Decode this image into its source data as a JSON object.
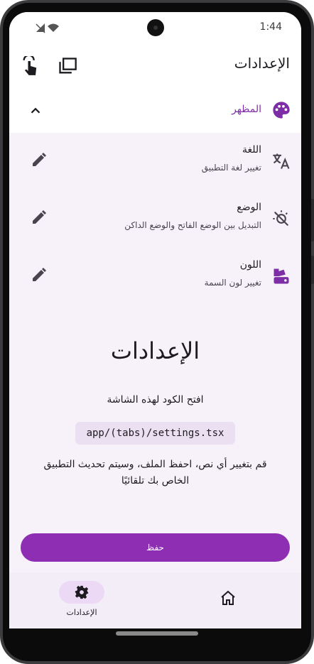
{
  "status_bar": {
    "time": "1:44"
  },
  "app_bar": {
    "title": "الإعدادات"
  },
  "accordion": {
    "label": "المظهر",
    "accent": "#7d2ea6"
  },
  "settings_items": [
    {
      "title": "اللغة",
      "subtitle": "تغيير لغة التطبيق",
      "icon": "translate-icon"
    },
    {
      "title": "الوضع",
      "subtitle": "التبديل بين الوضع الفاتح والوضع الداكن",
      "icon": "theme-mode-icon"
    },
    {
      "title": "اللون",
      "subtitle": "تغيير لون السمة",
      "icon": "palette-swatch-icon"
    }
  ],
  "content": {
    "title": "الإعدادات",
    "open_code": "افتح الكود لهذه الشاشة",
    "code_path": "app/(tabs)/settings.tsx",
    "hint": "قم بتغيير أي نص، احفظ الملف، وسيتم تحديث التطبيق الخاص بك تلقائيًا"
  },
  "save_button": {
    "label": "حفظ",
    "color": "#8e2fb3"
  },
  "bottom_nav": {
    "settings_label": "الإعدادات"
  }
}
